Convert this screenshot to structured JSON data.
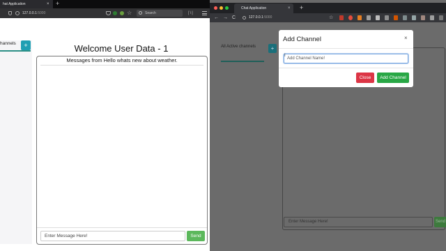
{
  "left_window": {
    "tab_title": "hat Application",
    "tab_close": "×",
    "new_tab": "+",
    "url_host": "127.0.0.1",
    "url_port": ":5000",
    "search_placeholder": "Search",
    "library_glyph": "|\\|",
    "channels_label": "hannels",
    "add_channel_label": "+",
    "page_title": "Welcome User Data - 1",
    "messages_header": "Messages from Hello whats new about weather.",
    "message_input_placeholder": "Enter Message Here!",
    "send_label": "Send"
  },
  "right_window": {
    "tab_title": "Chat Application",
    "tab_close": "×",
    "new_tab": "+",
    "nav_back": "←",
    "nav_forward": "→",
    "nav_reload": "C",
    "url_host": "127.0.0.1",
    "url_port": ":5000",
    "bookmark_glyph": "☆",
    "channels_label": "All Active channels",
    "add_channel_label": "+",
    "message_input_placeholder": "Enter Message Here!",
    "send_label": "Send",
    "modal": {
      "title": "Add Channel",
      "close_glyph": "×",
      "input_placeholder": "Add Channel Name!",
      "cursor_glyph": "I",
      "close_button": "Close",
      "add_button": "Add Channel"
    }
  },
  "colors": {
    "mac_close": "#ff5f57",
    "mac_minimize": "#febc2e",
    "mac_maximize": "#28c840",
    "send_green": "#5cb85c",
    "add_teal": "#1f9fb3",
    "danger_red": "#dc3545",
    "success_green": "#28a745"
  }
}
